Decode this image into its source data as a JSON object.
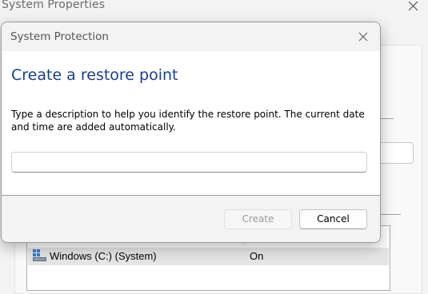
{
  "background_window": {
    "title": "System Properties",
    "close_icon": "close-icon",
    "drive_list": {
      "rows": [
        {
          "name": "Windows (C:) (System)",
          "status": "On",
          "icon": "drive-icon"
        }
      ]
    }
  },
  "dialog": {
    "title": "System Protection",
    "close_icon": "close-icon",
    "heading": "Create a restore point",
    "description": "Type a description to help you identify the restore point. The current date and time are added automatically.",
    "input": {
      "value": "",
      "placeholder": ""
    },
    "buttons": {
      "create_label": "Create",
      "cancel_label": "Cancel"
    }
  },
  "colors": {
    "heading": "#1a3d8f",
    "disabled_text": "#9b9b9b",
    "footer_bg": "#f3f3f3"
  }
}
